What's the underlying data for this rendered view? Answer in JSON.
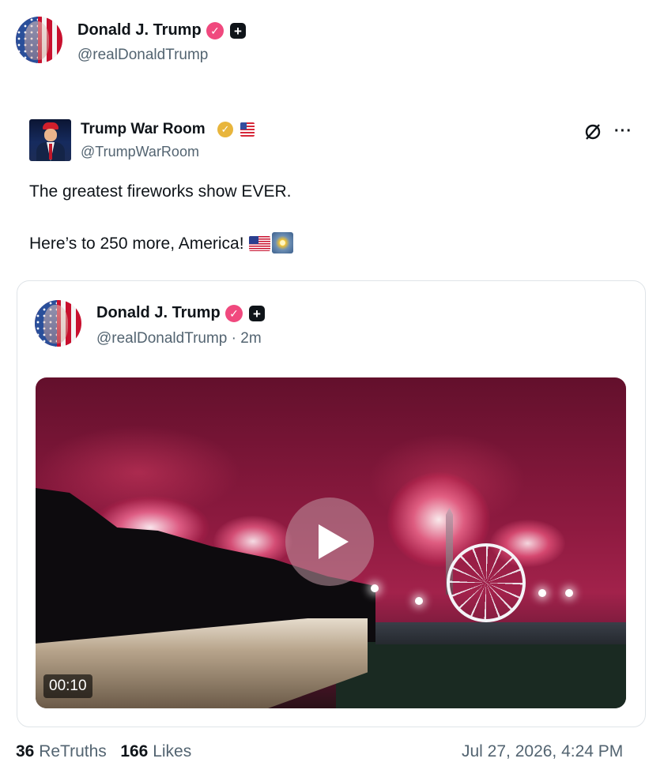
{
  "post": {
    "author_name": "Donald J. Trump",
    "author_handle": "@realDonaldTrump",
    "verified_color": "#f0497e"
  },
  "retruth": {
    "author_name": "Trump War Room",
    "author_handle": "@TrumpWarRoom",
    "verified_color": "#e8b53c",
    "text_line1": "The greatest fireworks show EVER.",
    "text_line2": "Here’s to 250 more, America!",
    "icons": [
      "no-sign-icon",
      "more-options-icon"
    ]
  },
  "quoted": {
    "author_name": "Donald J. Trump",
    "author_handle": "@realDonaldTrump",
    "time_ago": "· 2m",
    "video_duration": "00:10"
  },
  "stats": {
    "retruths_count": "36",
    "retruths_label": "ReTruths",
    "likes_count": "166",
    "likes_label": "Likes",
    "timestamp": "Jul 27, 2026, 4:24 PM"
  }
}
